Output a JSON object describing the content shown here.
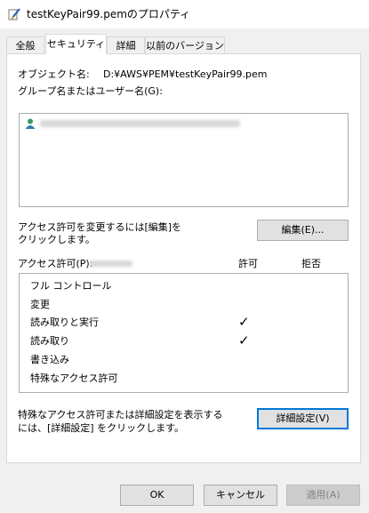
{
  "window": {
    "title": "testKeyPair99.pemのプロパティ",
    "icon": "file-properties-icon"
  },
  "tabs": [
    {
      "label": "全般"
    },
    {
      "label": "セキュリティ",
      "active": true
    },
    {
      "label": "詳細"
    },
    {
      "label": "以前のバージョン"
    }
  ],
  "object": {
    "label": "オブジェクト名:",
    "value": "D:¥AWS¥PEM¥testKeyPair99.pem"
  },
  "groups": {
    "label": "グループ名またはユーザー名(G):",
    "user_icon": "user-icon"
  },
  "edit_hint": {
    "line1": "アクセス許可を変更するには[編集]を",
    "line2": "クリックします。"
  },
  "edit_button": "編集(E)...",
  "permissions": {
    "label": "アクセス許可(P):",
    "allow_header": "許可",
    "deny_header": "拒否",
    "rows": [
      {
        "name": "フル コントロール",
        "allow": "",
        "deny": ""
      },
      {
        "name": "変更",
        "allow": "",
        "deny": ""
      },
      {
        "name": "読み取りと実行",
        "allow": "✓",
        "deny": ""
      },
      {
        "name": "読み取り",
        "allow": "✓",
        "deny": ""
      },
      {
        "name": "書き込み",
        "allow": "",
        "deny": ""
      },
      {
        "name": "特殊なアクセス許可",
        "allow": "",
        "deny": ""
      }
    ]
  },
  "advanced_hint": {
    "line1": "特殊なアクセス許可または詳細設定を表示する",
    "line2": "には、[詳細設定] をクリックします。"
  },
  "advanced_button": "詳細設定(V)",
  "footer": {
    "ok": "OK",
    "cancel": "キャンセル",
    "apply": "適用(A)"
  }
}
